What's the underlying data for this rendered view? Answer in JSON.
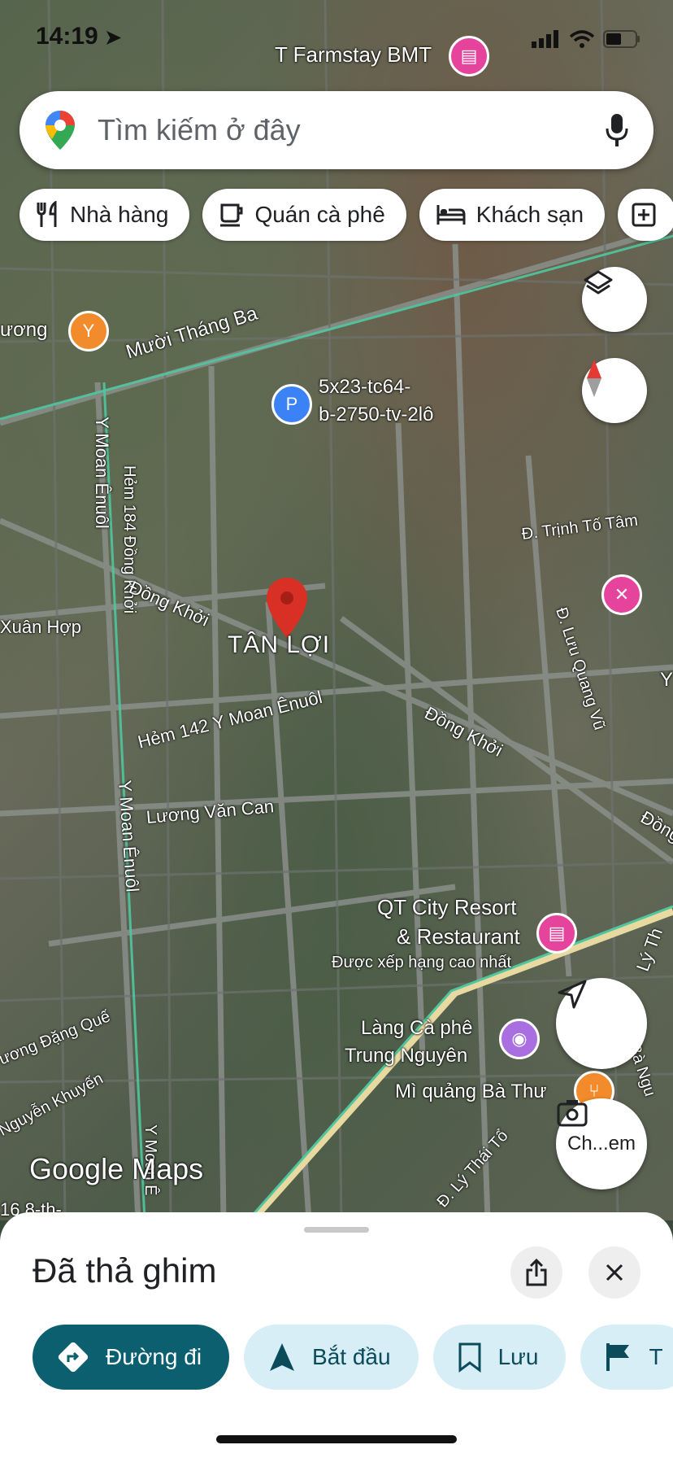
{
  "status_bar": {
    "time": "14:19"
  },
  "search": {
    "placeholder": "Tìm kiếm ở đây"
  },
  "chips": [
    "Nhà hàng",
    "Quán cà phê",
    "Khách sạn"
  ],
  "map": {
    "labels": {
      "farmstay": "T Farmstay BMT",
      "muong": "ương",
      "muoi_thang_ba": "Mười Tháng Ba",
      "parking_line1": "5x23-tc64-",
      "parking_line2": "b-2750-tv-2lô",
      "hem184": "Hẻm 184 Đồng Khởi",
      "y_moan_1": "Y Moan Ênuôl",
      "dong_khoi_1": "Đồng Khởi",
      "trinh_to_tam": "Đ. Trịnh Tố Tâm",
      "xuan_hop": "Xuân Hợp",
      "tan_loi": "TÂN LỢI",
      "luu_quang_vu": "Đ. Lưu Quang Vũ",
      "y_right": "Y",
      "dong_khoi_2": "Đồng Khởi",
      "hem142": "Hẻm 142 Y Moan Ênuôl",
      "luong_van_can": "Lương Văn Can",
      "dong_right": "Đồng",
      "y_moan_2": "Y Moan Ênuôl",
      "qt_line1": "QT City Resort",
      "qt_line2": "& Restaurant",
      "qt_rating": "Được xếp hạng cao nhất",
      "ly_th": "Lý Th",
      "lang_line1": "Làng Cà phê",
      "lang_line2": "Trung Nguyên",
      "dang_que": "ương Đặng Quế",
      "ba_ngu": "Bà Ngu",
      "mi_quang": "Mì quảng Bà Thư",
      "nguyen_khuyen": "Nguyễn Khuyến",
      "ly_thai_to": "Đ. Lý Thái Tổ",
      "y_moan_3": "Y Moan Ê",
      "lot_168": "16.8-th-"
    },
    "watermark_google": "Google",
    "watermark_maps": "Maps",
    "lens_label": "Ch...em"
  },
  "sheet": {
    "title": "Đã thả ghim",
    "actions": [
      "Đường đi",
      "Bắt đầu",
      "Lưu",
      "T"
    ]
  },
  "colors": {
    "primary_action": "#0b5f6e",
    "secondary_action": "#d7eef7",
    "pin_red": "#d93025",
    "poi_pink": "#e6439c",
    "poi_orange": "#f28b2b",
    "poi_purple": "#a96ee0",
    "poi_blue": "#3b82f6"
  }
}
